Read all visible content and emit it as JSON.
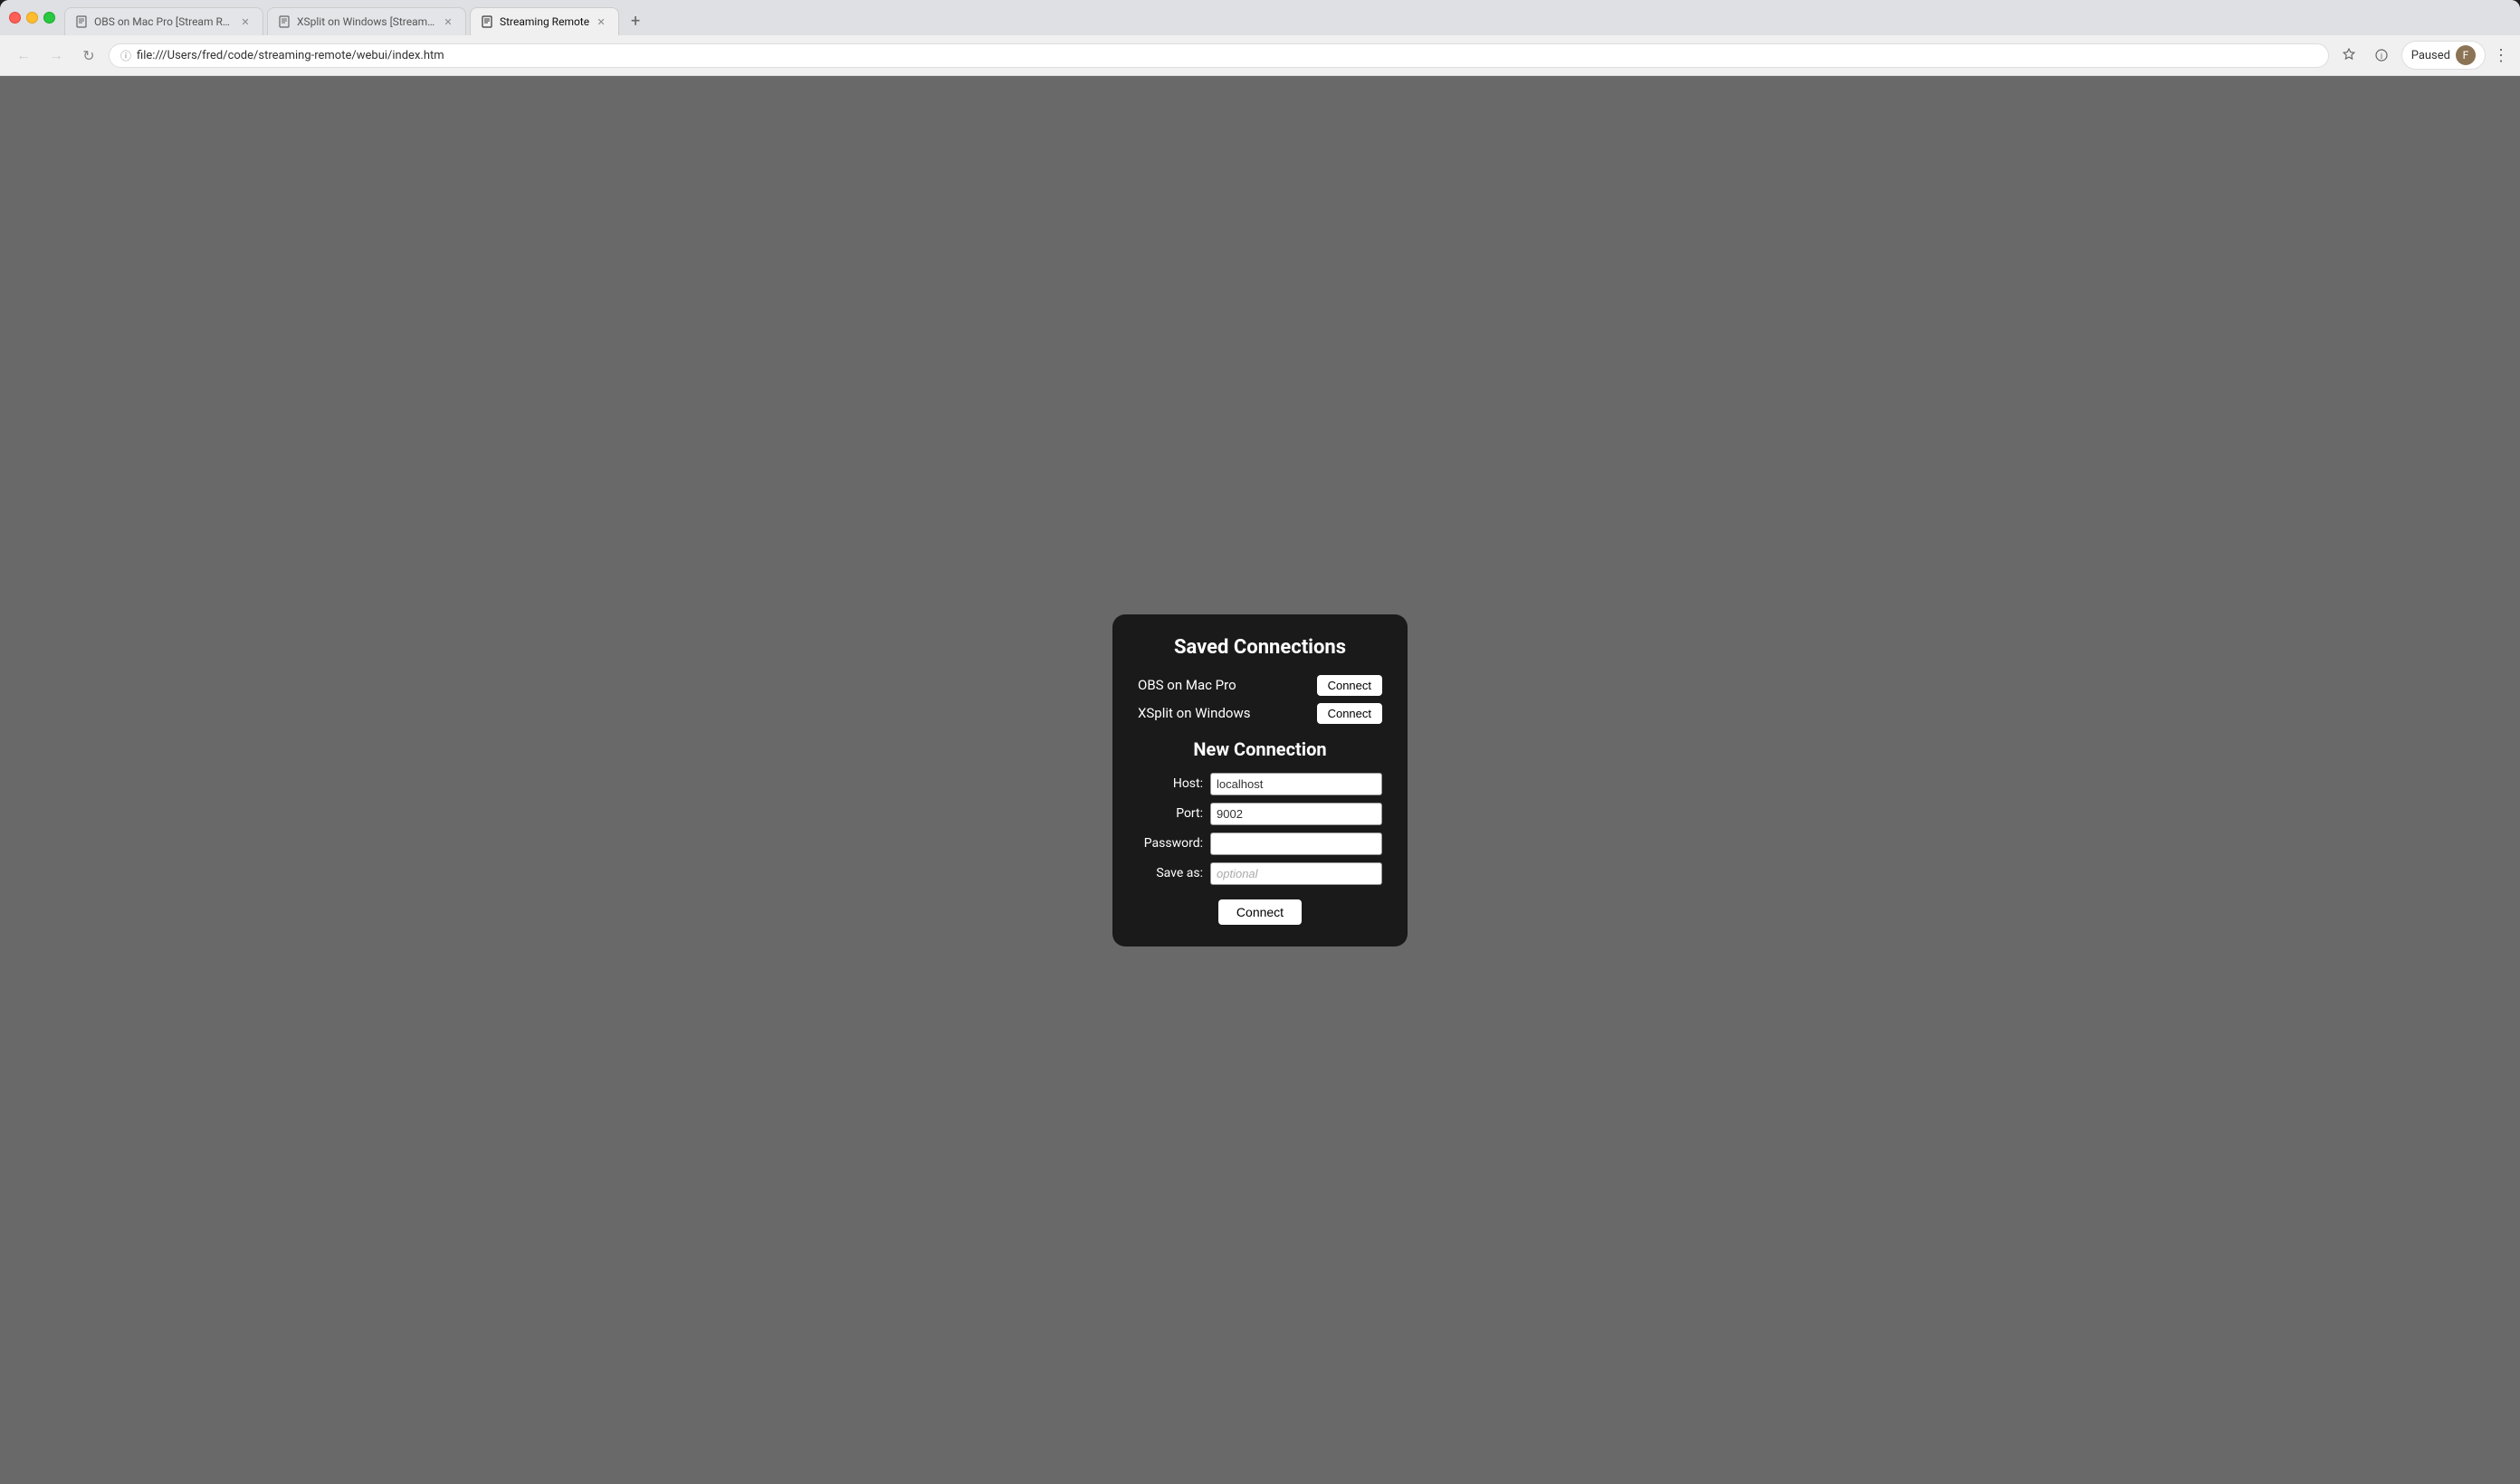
{
  "browser": {
    "tabs": [
      {
        "id": "tab1",
        "title": "OBS on Mac Pro [Stream Rem...",
        "active": false
      },
      {
        "id": "tab2",
        "title": "XSplit on Windows [Stream Re...",
        "active": false
      },
      {
        "id": "tab3",
        "title": "Streaming Remote",
        "active": true
      }
    ],
    "address": "file:///Users/fred/code/streaming-remote/webui/index.htm",
    "paused_label": "Paused",
    "new_tab_label": "+"
  },
  "panel": {
    "title": "Saved Connections",
    "saved_connections": [
      {
        "name": "OBS on Mac Pro",
        "button": "Connect"
      },
      {
        "name": "XSplit on Windows",
        "button": "Connect"
      }
    ],
    "new_connection_title": "New Connection",
    "form": {
      "host_label": "Host:",
      "host_value": "localhost",
      "port_label": "Port:",
      "port_value": "9002",
      "password_label": "Password:",
      "password_value": "",
      "save_as_label": "Save as:",
      "save_as_placeholder": "optional",
      "connect_button": "Connect"
    }
  }
}
